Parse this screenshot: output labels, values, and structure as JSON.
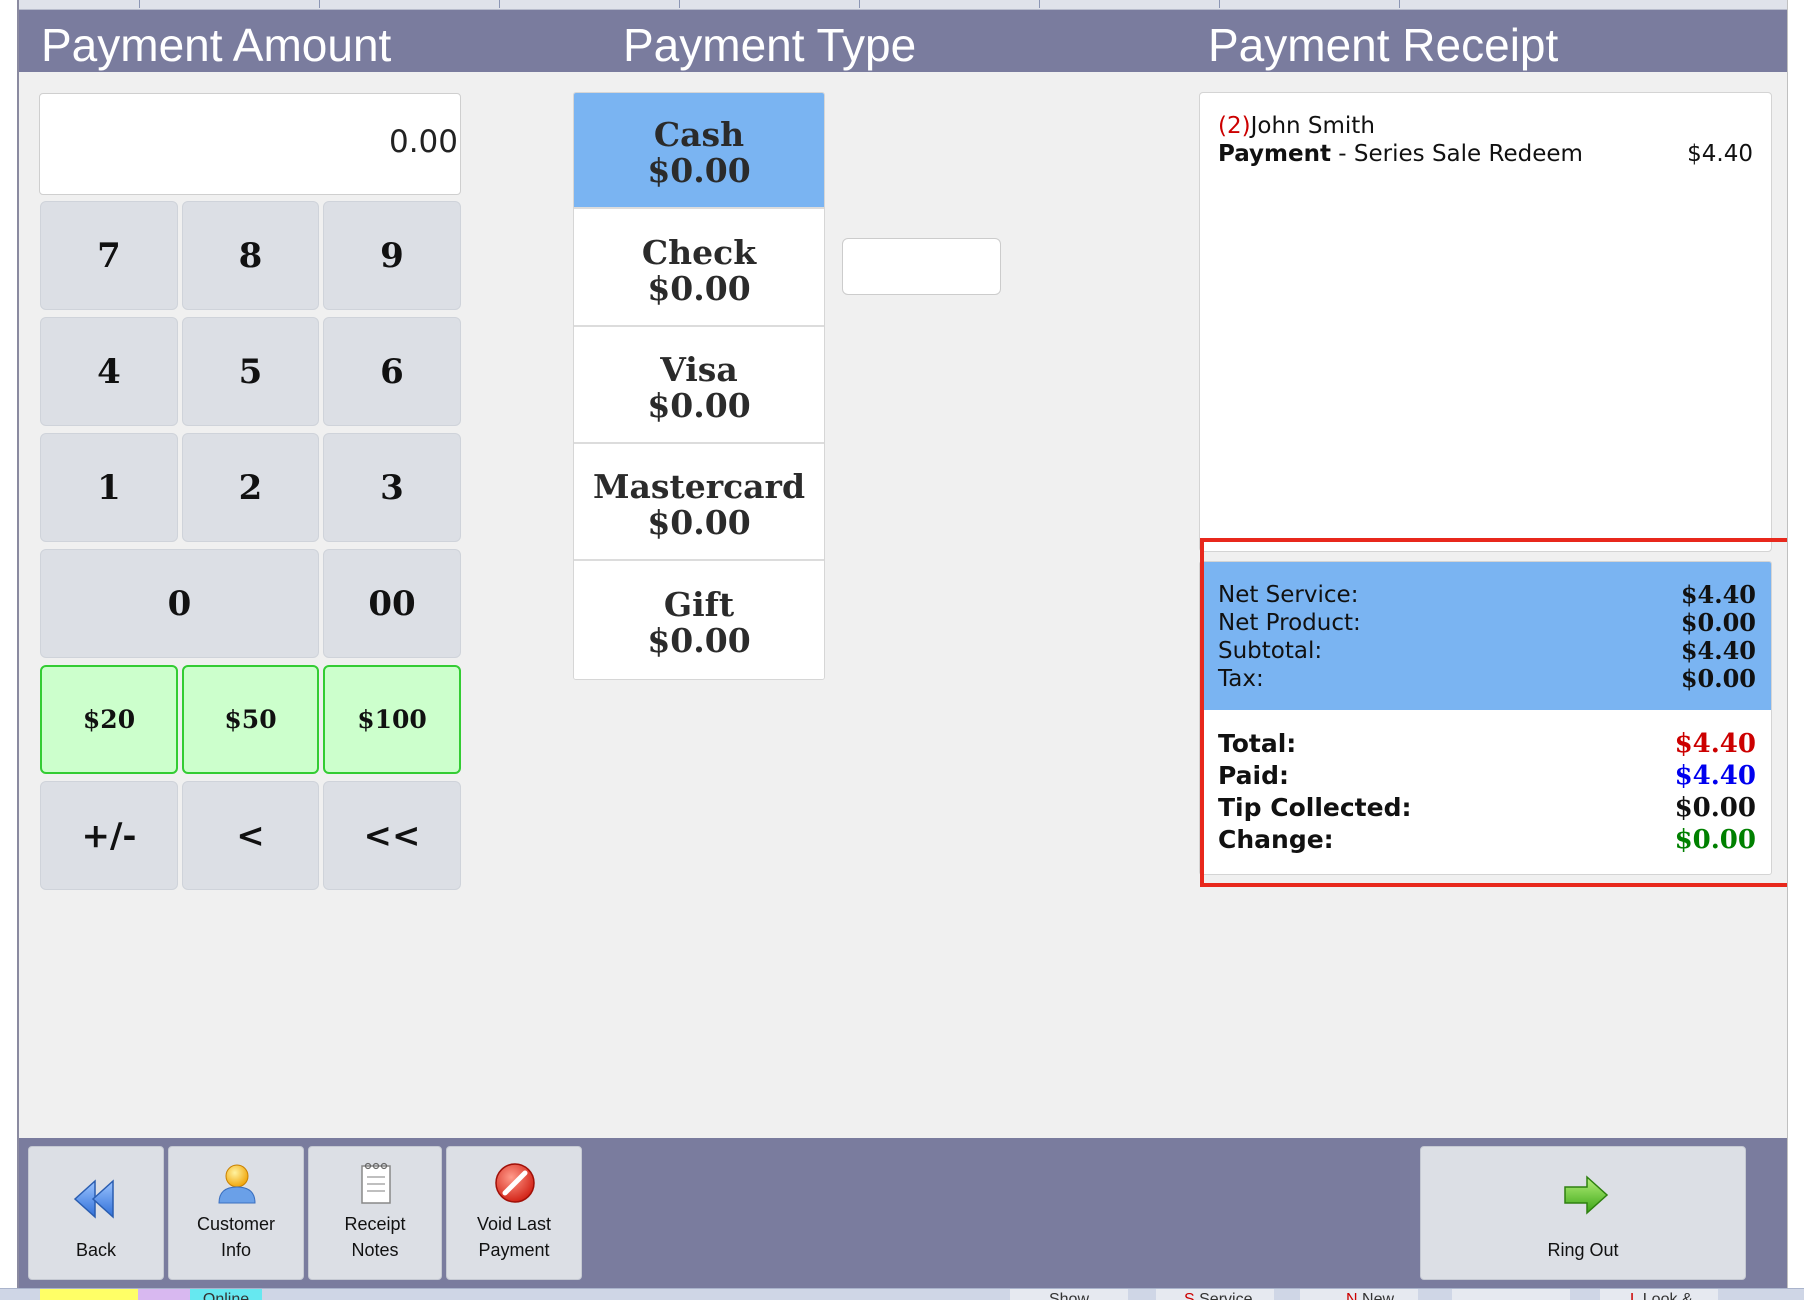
{
  "headers": {
    "payment_amount": "Payment Amount",
    "payment_type": "Payment Type",
    "payment_receipt": "Payment Receipt"
  },
  "amount_display": "0.00",
  "keypad": {
    "k7": "7",
    "k8": "8",
    "k9": "9",
    "k4": "4",
    "k5": "5",
    "k6": "6",
    "k1": "1",
    "k2": "2",
    "k3": "3",
    "k0": "0",
    "k00": "00",
    "q20": "$20",
    "q50": "$50",
    "q100": "$100",
    "plusminus": "+/-",
    "back_one": "<",
    "back_all": "<<"
  },
  "payment_types": [
    {
      "name": "Cash",
      "amount": "$0.00",
      "selected": true
    },
    {
      "name": "Check",
      "amount": "$0.00",
      "selected": false
    },
    {
      "name": "Visa",
      "amount": "$0.00",
      "selected": false
    },
    {
      "name": "Mastercard",
      "amount": "$0.00",
      "selected": false
    },
    {
      "name": "Gift",
      "amount": "$0.00",
      "selected": false
    }
  ],
  "receipt": {
    "customer_number": "(2)",
    "customer_name": "John Smith",
    "line_label": "Payment",
    "line_desc": " - Series Sale Redeem",
    "line_amount": "$4.40"
  },
  "summary": {
    "net_service_label": "Net Service:",
    "net_service": "$4.40",
    "net_product_label": "Net Product:",
    "net_product": "$0.00",
    "subtotal_label": "Subtotal:",
    "subtotal": "$4.40",
    "tax_label": "Tax:",
    "tax": "$0.00",
    "total_label": "Total:",
    "total": "$4.40",
    "paid_label": "Paid:",
    "paid": "$4.40",
    "tip_label": "Tip Collected:",
    "tip": "$0.00",
    "change_label": "Change:",
    "change": "$0.00"
  },
  "colors": {
    "header_bg": "#7a7c9e",
    "selected_blue": "#7ab4f2",
    "total_red": "#cc0000",
    "paid_blue": "#0000ee",
    "change_green": "#008000",
    "highlight_red": "#e8281c",
    "quick_green": "#ccffcc"
  },
  "toolbar": {
    "back": "Back",
    "customer_info": "Customer\nInfo",
    "receipt_notes": "Receipt\nNotes",
    "void_last_payment": "Void Last\nPayment",
    "ring_out": "Ring Out"
  },
  "taskbar": {
    "left_text": "Online",
    "show": "Show",
    "service_key": "S",
    "service": "Service",
    "new_key": "N",
    "new": "New",
    "look_key": "L",
    "look": "Look &"
  }
}
